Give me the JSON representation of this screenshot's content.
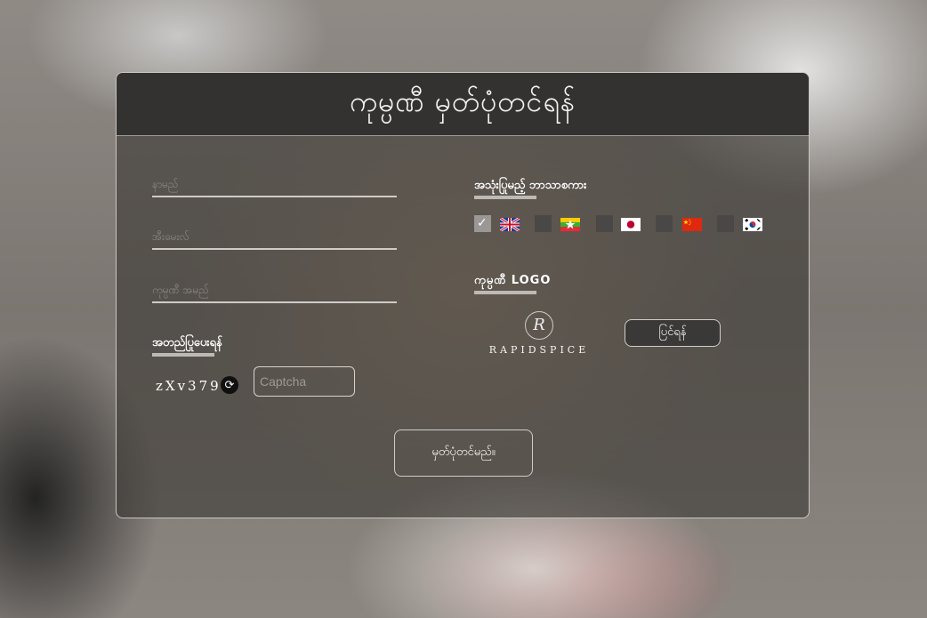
{
  "form": {
    "title": "ကုမ္ပဏီ မှတ်ပုံတင်ရန်",
    "fields": {
      "name_placeholder": "နာမည်",
      "email_placeholder": "အီးမေးလ်",
      "company_placeholder": "ကုမ္ပဏီ အမည်"
    },
    "verify_label": "အတည်ပြုပေးရန်",
    "captcha_code": "zXv379",
    "captcha_placeholder": "Captcha",
    "submit_label": "မှတ်ပုံတင်မည်။"
  },
  "language": {
    "label": "အသုံးပြုမည့် ဘာသာစကား",
    "options": [
      {
        "flag": "uk-flag",
        "checked": true
      },
      {
        "flag": "myanmar-flag",
        "checked": false
      },
      {
        "flag": "japan-flag",
        "checked": false
      },
      {
        "flag": "china-flag",
        "checked": false
      },
      {
        "flag": "korea-flag",
        "checked": false
      }
    ]
  },
  "logo": {
    "label": "ကုမ္ပဏီ LOGO",
    "brand_text": "RAPIDSPICE",
    "change_label": "ပြင်ရန်"
  },
  "colors": {
    "header_bg": "#333231",
    "panel_border": "#c9c6c2",
    "checked_box": "#9a9794"
  }
}
